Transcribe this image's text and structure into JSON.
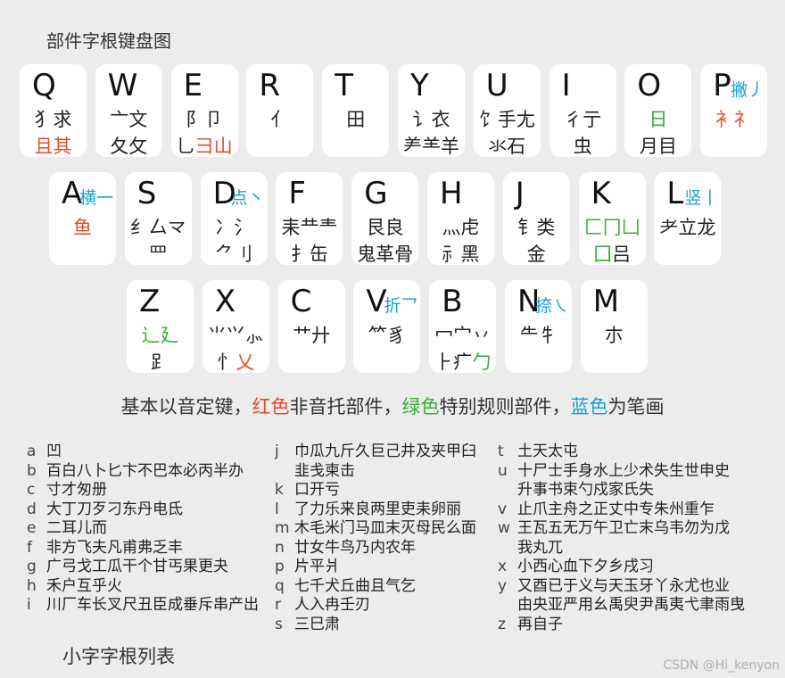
{
  "title": "部件字根键盘图",
  "keys": [
    {
      "k": "Q",
      "l1": [
        [
          "犭求",
          ""
        ]
      ],
      "l2": [
        [
          "且其",
          "red"
        ]
      ]
    },
    {
      "k": "W",
      "l1": [
        [
          "亠文",
          ""
        ]
      ],
      "l2": [
        [
          "夂攵",
          ""
        ]
      ]
    },
    {
      "k": "E",
      "l1": [
        [
          "阝卩",
          ""
        ]
      ],
      "l2": [
        [
          "⺃",
          ""
        ],
        [
          "彐山",
          "red"
        ]
      ]
    },
    {
      "k": "R",
      "l1": [
        [
          "亻",
          ""
        ]
      ],
      "l2": []
    },
    {
      "k": "T",
      "l1": [
        [
          "田",
          ""
        ]
      ],
      "l2": []
    },
    {
      "k": "Y",
      "l1": [
        [
          "讠衣",
          ""
        ]
      ],
      "l2": [
        [
          "⺶⺷羊",
          ""
        ]
      ]
    },
    {
      "k": "U",
      "l1": [
        [
          "饣手尢",
          ""
        ]
      ],
      "l2": [
        [
          "氺石",
          ""
        ]
      ]
    },
    {
      "k": "I",
      "l1": [
        [
          "彳亍",
          ""
        ]
      ],
      "l2": [
        [
          "虫",
          ""
        ]
      ]
    },
    {
      "k": "O",
      "l1": [
        [
          "日",
          "green"
        ]
      ],
      "l2": [
        [
          "月目",
          ""
        ]
      ]
    },
    {
      "k": "P",
      "note": "撇丿",
      "l1": [
        [
          "衤礻",
          "red"
        ]
      ],
      "l2": []
    },
    {
      "k": "A",
      "note": "横一",
      "l1": [
        [
          "鱼",
          "red"
        ]
      ],
      "l2": []
    },
    {
      "k": "S",
      "l1": [
        [
          "纟厶龴",
          ""
        ]
      ],
      "l2": [
        [
          "罒",
          ""
        ]
      ]
    },
    {
      "k": "D",
      "note": "点丶",
      "l1": [
        [
          "冫氵",
          ""
        ]
      ],
      "l2": [
        [
          "⺈刂",
          ""
        ]
      ]
    },
    {
      "k": "F",
      "l1": [
        [
          "耒龷龶",
          ""
        ]
      ],
      "l2": [
        [
          "扌缶",
          ""
        ]
      ]
    },
    {
      "k": "G",
      "l1": [
        [
          "艮良",
          ""
        ]
      ],
      "l2": [
        [
          "鬼革骨",
          ""
        ]
      ]
    },
    {
      "k": "H",
      "l1": [
        [
          "灬虍",
          ""
        ]
      ],
      "l2": [
        [
          "⺬黑",
          ""
        ]
      ]
    },
    {
      "k": "J",
      "l1": [
        [
          "钅类",
          ""
        ]
      ],
      "l2": [
        [
          "金",
          ""
        ]
      ]
    },
    {
      "k": "K",
      "l1": [
        [
          "匚冂凵",
          "green"
        ]
      ],
      "l2": [
        [
          "囗",
          "green"
        ],
        [
          "吕",
          ""
        ]
      ]
    },
    {
      "k": "L",
      "note": "竖丨",
      "l1": [
        [
          "⺹立龙",
          ""
        ]
      ],
      "l2": []
    },
    {
      "k": "Z",
      "l1": [
        [
          "辶廴",
          "green"
        ]
      ],
      "l2": [
        [
          "⻊",
          ""
        ]
      ]
    },
    {
      "k": "X",
      "l1": [
        [
          "⺌⺍⺗",
          ""
        ]
      ],
      "l2": [
        [
          "忄",
          ""
        ],
        [
          "乂",
          "red"
        ]
      ]
    },
    {
      "k": "C",
      "l1": [
        [
          "艹廾",
          ""
        ]
      ],
      "l2": []
    },
    {
      "k": "V",
      "note": "折乛",
      "l1": [
        [
          "⺮豸",
          ""
        ]
      ],
      "l2": []
    },
    {
      "k": "B",
      "l1": [
        [
          "冖宀丷",
          ""
        ]
      ],
      "l2": [
        [
          "⺊疒",
          ""
        ],
        [
          "勹",
          "green"
        ]
      ]
    },
    {
      "k": "N",
      "note": "捺㇏",
      "l1": [
        [
          "⺧牜",
          ""
        ]
      ],
      "l2": []
    },
    {
      "k": "M",
      "l1": [
        [
          "朩",
          ""
        ]
      ],
      "l2": []
    }
  ],
  "legend": [
    [
      "基本以音定键，",
      ""
    ],
    [
      "红色",
      "red"
    ],
    [
      "非音托部件，",
      ""
    ],
    [
      "绿色",
      "green"
    ],
    [
      "特别规则部件，",
      ""
    ],
    [
      "蓝色",
      "blue"
    ],
    [
      "为笔画",
      ""
    ]
  ],
  "list": [
    {
      "l": "a",
      "t": [
        "凹"
      ]
    },
    {
      "l": "b",
      "t": [
        "百白八卜匕卞不巴本必丙半办"
      ]
    },
    {
      "l": "c",
      "t": [
        "寸才匆册"
      ]
    },
    {
      "l": "d",
      "t": [
        "大丁刀歹刁东丹电氐"
      ]
    },
    {
      "l": "e",
      "t": [
        "二耳儿而"
      ]
    },
    {
      "l": "f",
      "t": [
        "非方飞夫凡甫弗乏丰"
      ]
    },
    {
      "l": "g",
      "t": [
        "广弓戈工瓜干个甘丐果更夬"
      ]
    },
    {
      "l": "h",
      "t": [
        "禾户互乎火"
      ]
    },
    {
      "l": "i",
      "t": [
        "川厂车长叉尺丑臣成垂斥串产出"
      ]
    },
    {
      "l": "j",
      "t": [
        "巾瓜九斤久巨己井及夹甲臼",
        "韭戋柬击"
      ]
    },
    {
      "l": "k",
      "t": [
        "口开亏"
      ]
    },
    {
      "l": "l",
      "t": [
        "了力乐来良两里吏耒卵丽"
      ]
    },
    {
      "l": "m",
      "t": [
        "木毛米门马皿末灭母民么面"
      ]
    },
    {
      "l": "n",
      "t": [
        "廿女牛鸟乃内农年"
      ]
    },
    {
      "l": "p",
      "t": [
        "片平爿"
      ]
    },
    {
      "l": "q",
      "t": [
        "七千犬丘曲且气乞"
      ]
    },
    {
      "l": "r",
      "t": [
        "人入冉壬刃"
      ]
    },
    {
      "l": "s",
      "t": [
        "三巳肃"
      ]
    },
    {
      "l": "t",
      "t": [
        "土天太屯"
      ]
    },
    {
      "l": "u",
      "t": [
        "十尸士手身水上少术失生世申史",
        "升事书束勺戍家氏失"
      ]
    },
    {
      "l": "v",
      "t": [
        "止爪主舟之正丈中专朱州重乍"
      ]
    },
    {
      "l": "w",
      "t": [
        "王瓦五无万午卫亡末乌韦勿为戊",
        "我丸兀"
      ]
    },
    {
      "l": "x",
      "t": [
        "小西心血下夕乡戌习"
      ]
    },
    {
      "l": "y",
      "t": [
        "又酉已于义与天玉牙丫永尤也业",
        "由央亚严用幺禹臾尹禹夷弋聿雨曳"
      ]
    },
    {
      "l": "z",
      "t": [
        "再自子"
      ]
    }
  ],
  "caption": "小字字根列表",
  "watermark": "CSDN @Hi_kenyon"
}
